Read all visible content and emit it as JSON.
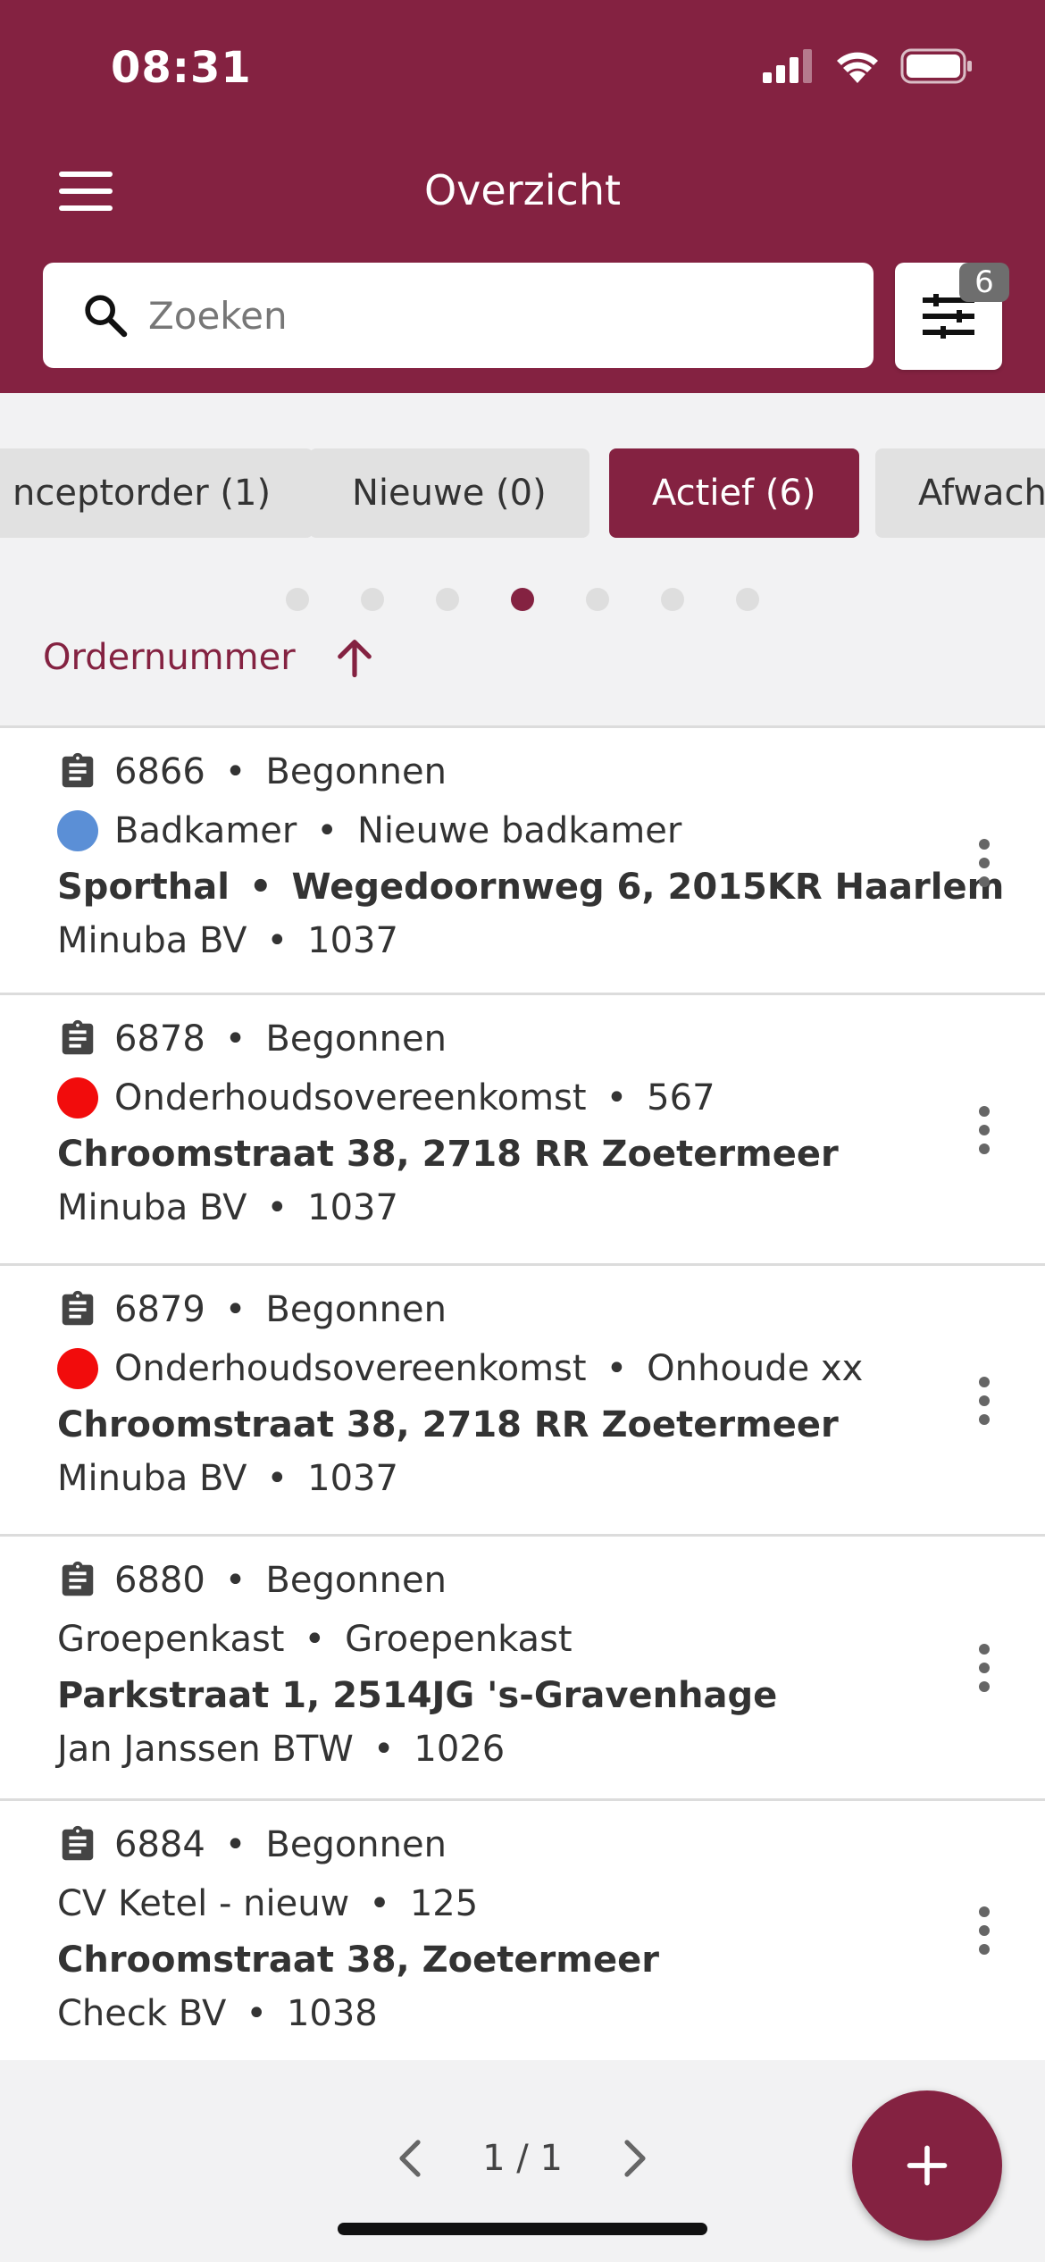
{
  "status": {
    "time": "08:31"
  },
  "header": {
    "title": "Overzicht",
    "search_placeholder": "Zoeken",
    "search_value": "",
    "filter_count": "6"
  },
  "tabs": [
    {
      "label": "nceptorder (1)",
      "active": false
    },
    {
      "label": "Nieuwe (0)",
      "active": false
    },
    {
      "label": "Actief (6)",
      "active": true
    },
    {
      "label": "Afwach",
      "active": false
    }
  ],
  "pager_dots": {
    "count": 7,
    "active_index": 3
  },
  "sort": {
    "label": "Ordernummer",
    "direction": "ascending"
  },
  "orders": [
    {
      "number": "6866",
      "status": "Begonnen",
      "category_color": "#5b8fd6",
      "category": "Badkamer",
      "description": "Nieuwe badkamer",
      "location_name": "Sporthal",
      "address": "Wegedoornweg 6, 2015KR Haarlem",
      "customer": "Minuba BV",
      "customer_no": "1037"
    },
    {
      "number": "6878",
      "status": "Begonnen",
      "category_color": "#f20c0c",
      "category": "Onderhoudsovereenkomst",
      "description": "567",
      "location_name": "",
      "address": "Chroomstraat 38, 2718 RR Zoetermeer",
      "customer": "Minuba BV",
      "customer_no": "1037"
    },
    {
      "number": "6879",
      "status": "Begonnen",
      "category_color": "#f20c0c",
      "category": "Onderhoudsovereenkomst",
      "description": "Onhoude xx",
      "location_name": "",
      "address": "Chroomstraat 38, 2718 RR Zoetermeer",
      "customer": "Minuba BV",
      "customer_no": "1037"
    },
    {
      "number": "6880",
      "status": "Begonnen",
      "category_color": "",
      "category": "Groepenkast",
      "description": "Groepenkast",
      "location_name": "",
      "address": "Parkstraat 1, 2514JG 's-Gravenhage",
      "customer": "Jan Janssen BTW",
      "customer_no": "1026"
    },
    {
      "number": "6884",
      "status": "Begonnen",
      "category_color": "",
      "category": "CV Ketel - nieuw",
      "description": "125",
      "location_name": "",
      "address": "Chroomstraat 38, Zoetermeer",
      "customer": "Check BV",
      "customer_no": "1038"
    }
  ],
  "pagination": {
    "text": "1 / 1"
  },
  "colors": {
    "brand": "#842241",
    "tab_inactive": "#e1e1e1"
  },
  "icons": [
    "menu-icon",
    "search-icon",
    "filter-sliders-icon",
    "arrow-up-icon",
    "clipboard-icon",
    "more-vertical-icon",
    "chevron-left-icon",
    "chevron-right-icon",
    "plus-icon",
    "signal-icon",
    "wifi-icon",
    "battery-icon"
  ]
}
